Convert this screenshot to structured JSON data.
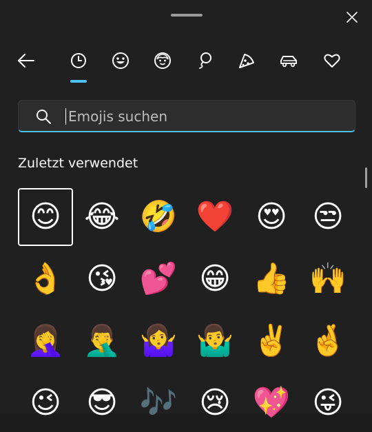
{
  "window": {
    "close_icon": "close-icon",
    "drag_handle": "drag-handle"
  },
  "nav": {
    "back_icon": "arrow-left-icon",
    "active_tab": "recent",
    "tabs": [
      {
        "id": "recent",
        "icon": "clock-icon"
      },
      {
        "id": "smileys",
        "icon": "smiley-icon"
      },
      {
        "id": "people",
        "icon": "person-face-icon"
      },
      {
        "id": "nature",
        "icon": "balloon-icon"
      },
      {
        "id": "food",
        "icon": "pizza-icon"
      },
      {
        "id": "travel",
        "icon": "car-icon"
      },
      {
        "id": "symbols",
        "icon": "heart-icon"
      }
    ],
    "accent": "#4cc2ff"
  },
  "search": {
    "placeholder": "Emojis suchen",
    "value": ""
  },
  "section": {
    "title": "Zuletzt verwendet"
  },
  "emojis": [
    [
      "😊",
      "😂",
      "🤣",
      "❤️",
      "😍",
      "😒"
    ],
    [
      "👌",
      "😘",
      "💕",
      "😁",
      "👍",
      "🙌"
    ],
    [
      "🤦‍♀️",
      "🤦‍♂️",
      "🤷‍♀️",
      "🤷‍♂️",
      "✌️",
      "🤞"
    ],
    [
      "😉",
      "😎",
      "🎶",
      "😢",
      "💖",
      "😜"
    ]
  ],
  "selected_emoji": "😊"
}
